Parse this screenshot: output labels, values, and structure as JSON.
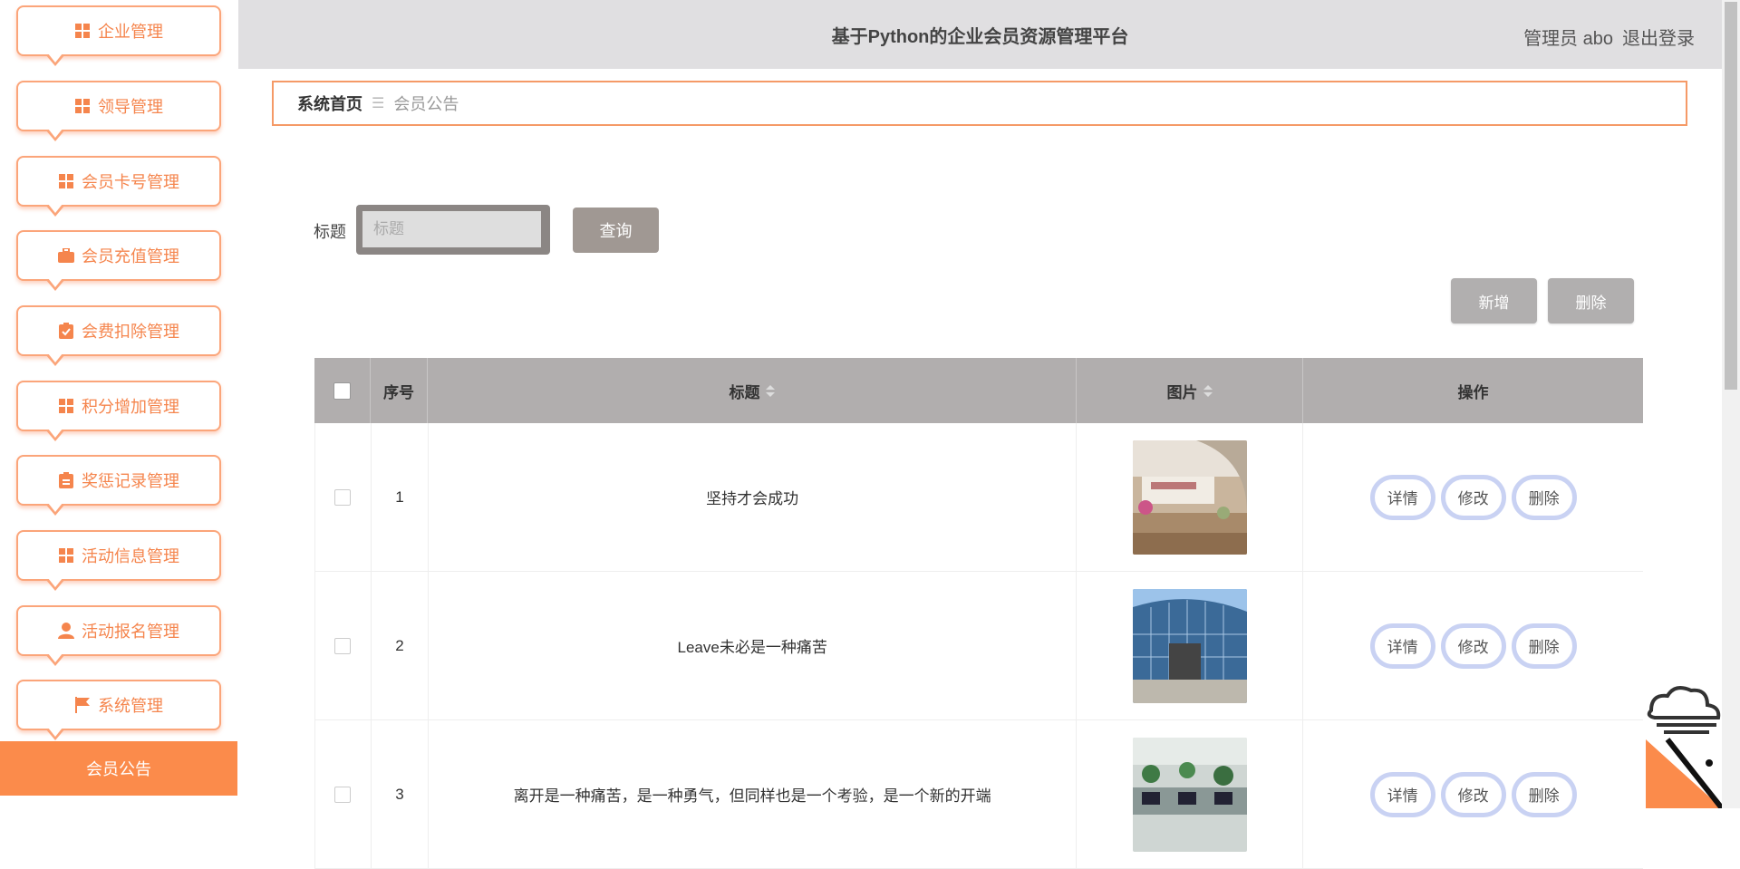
{
  "sidebar": {
    "items": [
      {
        "label": "企业管理",
        "icon": "grid-icon"
      },
      {
        "label": "领导管理",
        "icon": "grid-icon"
      },
      {
        "label": "会员卡号管理",
        "icon": "grid-icon"
      },
      {
        "label": "会员充值管理",
        "icon": "briefcase-icon"
      },
      {
        "label": "会费扣除管理",
        "icon": "clipboard-check-icon"
      },
      {
        "label": "积分增加管理",
        "icon": "grid-icon"
      },
      {
        "label": "奖惩记录管理",
        "icon": "clipboard-icon"
      },
      {
        "label": "活动信息管理",
        "icon": "grid-icon"
      },
      {
        "label": "活动报名管理",
        "icon": "user-icon"
      },
      {
        "label": "系统管理",
        "icon": "flag-icon"
      }
    ],
    "active_label": "会员公告",
    "accent_color": "#fb8b4b"
  },
  "header": {
    "title": "基于Python的企业会员资源管理平台",
    "user": "管理员 abo",
    "logout": "退出登录"
  },
  "breadcrumb": {
    "home": "系统首页",
    "separator": "☰",
    "current": "会员公告"
  },
  "search": {
    "label": "标题",
    "placeholder": "标题",
    "button": "查询"
  },
  "actions": {
    "add": "新增",
    "delete": "删除"
  },
  "table": {
    "headers": {
      "index": "序号",
      "title": "标题",
      "image": "图片",
      "ops": "操作"
    },
    "rows": [
      {
        "index": "1",
        "title": "坚持才会成功",
        "image": "building-lobby-photo"
      },
      {
        "index": "2",
        "title": "Leave未必是一种痛苦",
        "image": "glass-building-photo"
      },
      {
        "index": "3",
        "title": "离开是一种痛苦，是一种勇气，但同样也是一个考验，是一个新的开端",
        "image": "office-photo"
      }
    ],
    "row_buttons": {
      "detail": "详情",
      "edit": "修改",
      "delete": "删除"
    }
  }
}
